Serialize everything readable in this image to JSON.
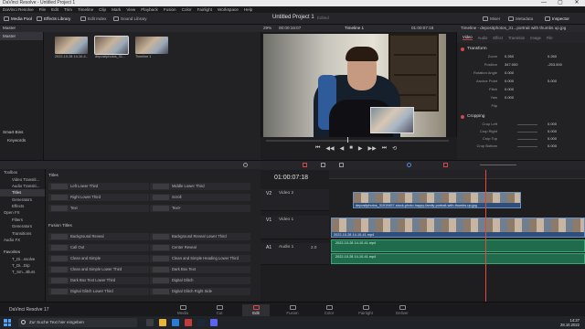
{
  "window": {
    "title": "DaVinci Resolve - Untitled Project 1",
    "controls": [
      "—",
      "▢",
      "✕"
    ]
  },
  "menu": [
    "DaVinci Resolve",
    "File",
    "Edit",
    "Trim",
    "Timeline",
    "Clip",
    "Mark",
    "View",
    "Playback",
    "Fusion",
    "Color",
    "Fairlight",
    "Workspace",
    "Help"
  ],
  "toolbar": {
    "media_pool": "Media Pool",
    "effects_library": "Effects Library",
    "edit_index": "Edit Index",
    "sound_library": "Sound Library",
    "project_title": "Untitled Project 1",
    "project_state": "Edited",
    "mixer": "Mixer",
    "metadata": "Metadata",
    "inspector": "Inspector"
  },
  "media_pool": {
    "header": "Master",
    "bins": [
      "Master"
    ],
    "smart_bins": "Smart Bins",
    "keywords": "Keywords",
    "clips": [
      {
        "name": "2022-10-28 14-10-4..."
      },
      {
        "name": "depositphotos_31..."
      },
      {
        "name": "Timeline 1"
      }
    ]
  },
  "viewer": {
    "zoom": "29%",
    "source_tc": "00:00:16:07",
    "timeline_name": "Timeline 1",
    "record_tc": "01:00:07:18",
    "transport": [
      "⏮",
      "◀◀",
      "◀",
      "■",
      "▶",
      "▶▶",
      "⏭",
      "⟲"
    ]
  },
  "inspector": {
    "header": "Timeline - depositphotos_31...portrait with thumbs up.jpg",
    "tabs": [
      "Video",
      "Audio",
      "Effect",
      "Transition",
      "Image",
      "File"
    ],
    "transform_label": "Transform",
    "transform_rows": [
      {
        "label": "Zoom",
        "x_label": "X",
        "x": "0.260",
        "y_label": "Y",
        "y": "0.260"
      },
      {
        "label": "Position",
        "x_label": "X",
        "x": "347.000",
        "y_label": "Y",
        "y": "-253.000"
      },
      {
        "label": "Rotation Angle",
        "x_label": "",
        "x": "0.000",
        "y_label": "",
        "y": ""
      },
      {
        "label": "Anchor Point",
        "x_label": "X",
        "x": "0.000",
        "y_label": "Y",
        "y": "0.000"
      },
      {
        "label": "Pitch",
        "x_label": "",
        "x": "0.000",
        "y_label": "",
        "y": ""
      },
      {
        "label": "Yaw",
        "x_label": "",
        "x": "0.000",
        "y_label": "",
        "y": ""
      },
      {
        "label": "Flip",
        "x_label": "",
        "x": "",
        "y_label": "",
        "y": ""
      }
    ],
    "cropping_label": "Cropping",
    "crop_rows": [
      {
        "label": "Crop Left",
        "value": "0.000"
      },
      {
        "label": "Crop Right",
        "value": "0.000"
      },
      {
        "label": "Crop Top",
        "value": "0.000"
      },
      {
        "label": "Crop Bottom",
        "value": "0.000"
      }
    ]
  },
  "effects": {
    "tree": [
      {
        "label": "Toolbox",
        "level": 0
      },
      {
        "label": "Video Transiti...",
        "level": 1
      },
      {
        "label": "Audio Transiti...",
        "level": 1
      },
      {
        "label": "Titles",
        "level": 1,
        "selected": true
      },
      {
        "label": "Generators",
        "level": 1
      },
      {
        "label": "Effects",
        "level": 1
      },
      {
        "label": "Open FX",
        "level": 0
      },
      {
        "label": "Filters",
        "level": 1
      },
      {
        "label": "Generators",
        "level": 1
      },
      {
        "label": "Transitions",
        "level": 1
      },
      {
        "label": "Audio FX",
        "level": 0
      }
    ],
    "favorites_label": "Favorites",
    "favorites": [
      "T_Di...ssolve",
      "T_Di...Dip",
      "T_Sm...Blurs"
    ],
    "titles_category": "Titles",
    "titles": [
      "Left Lower Third",
      "Middle Lower Third",
      "Right Lower Third",
      "Scroll",
      "Text",
      "Text+"
    ],
    "fusion_category": "Fusion Titles",
    "fusion_titles": [
      "Background Reveal",
      "Background Reveal Lower Third",
      "Call Out",
      "Center Reveal",
      "Clean and Simple",
      "Clean and Simple Heading Lower Third",
      "Clean and Simple Lower Third",
      "Dark Box Text",
      "Dark Box Text Lower Third",
      "Digital Glitch",
      "Digital Glitch Lower Third",
      "Digital Glitch Right Side"
    ]
  },
  "timeline": {
    "timecode": "01:00:07:18",
    "tracks": [
      {
        "id": "V2",
        "name": "Video 2"
      },
      {
        "id": "V1",
        "name": "Video 1"
      },
      {
        "id": "A1",
        "name": "Audio 1",
        "level": "2.0"
      }
    ],
    "clips": {
      "v2": "depositphotos_31919457-stock-photo-happy-family-portrait-with-thumbs-up.jpg",
      "v1": "2022-10-28 14-10-41.mp4",
      "a1": "2022-10-28 14-10-41.mp4"
    }
  },
  "pages": [
    "Media",
    "Cut",
    "Edit",
    "Fusion",
    "Color",
    "Fairlight",
    "Deliver"
  ],
  "active_page": "Edit",
  "app_name": "DaVinci Resolve 17",
  "taskbar": {
    "search_placeholder": "Zur Suche Text hier eingeben",
    "time": "14:27",
    "date": "28.10.2022"
  },
  "colors": {
    "accent_red": "#e04a3c",
    "video_clip": "#2f4f7a",
    "audio_clip": "#1f6b4c"
  }
}
